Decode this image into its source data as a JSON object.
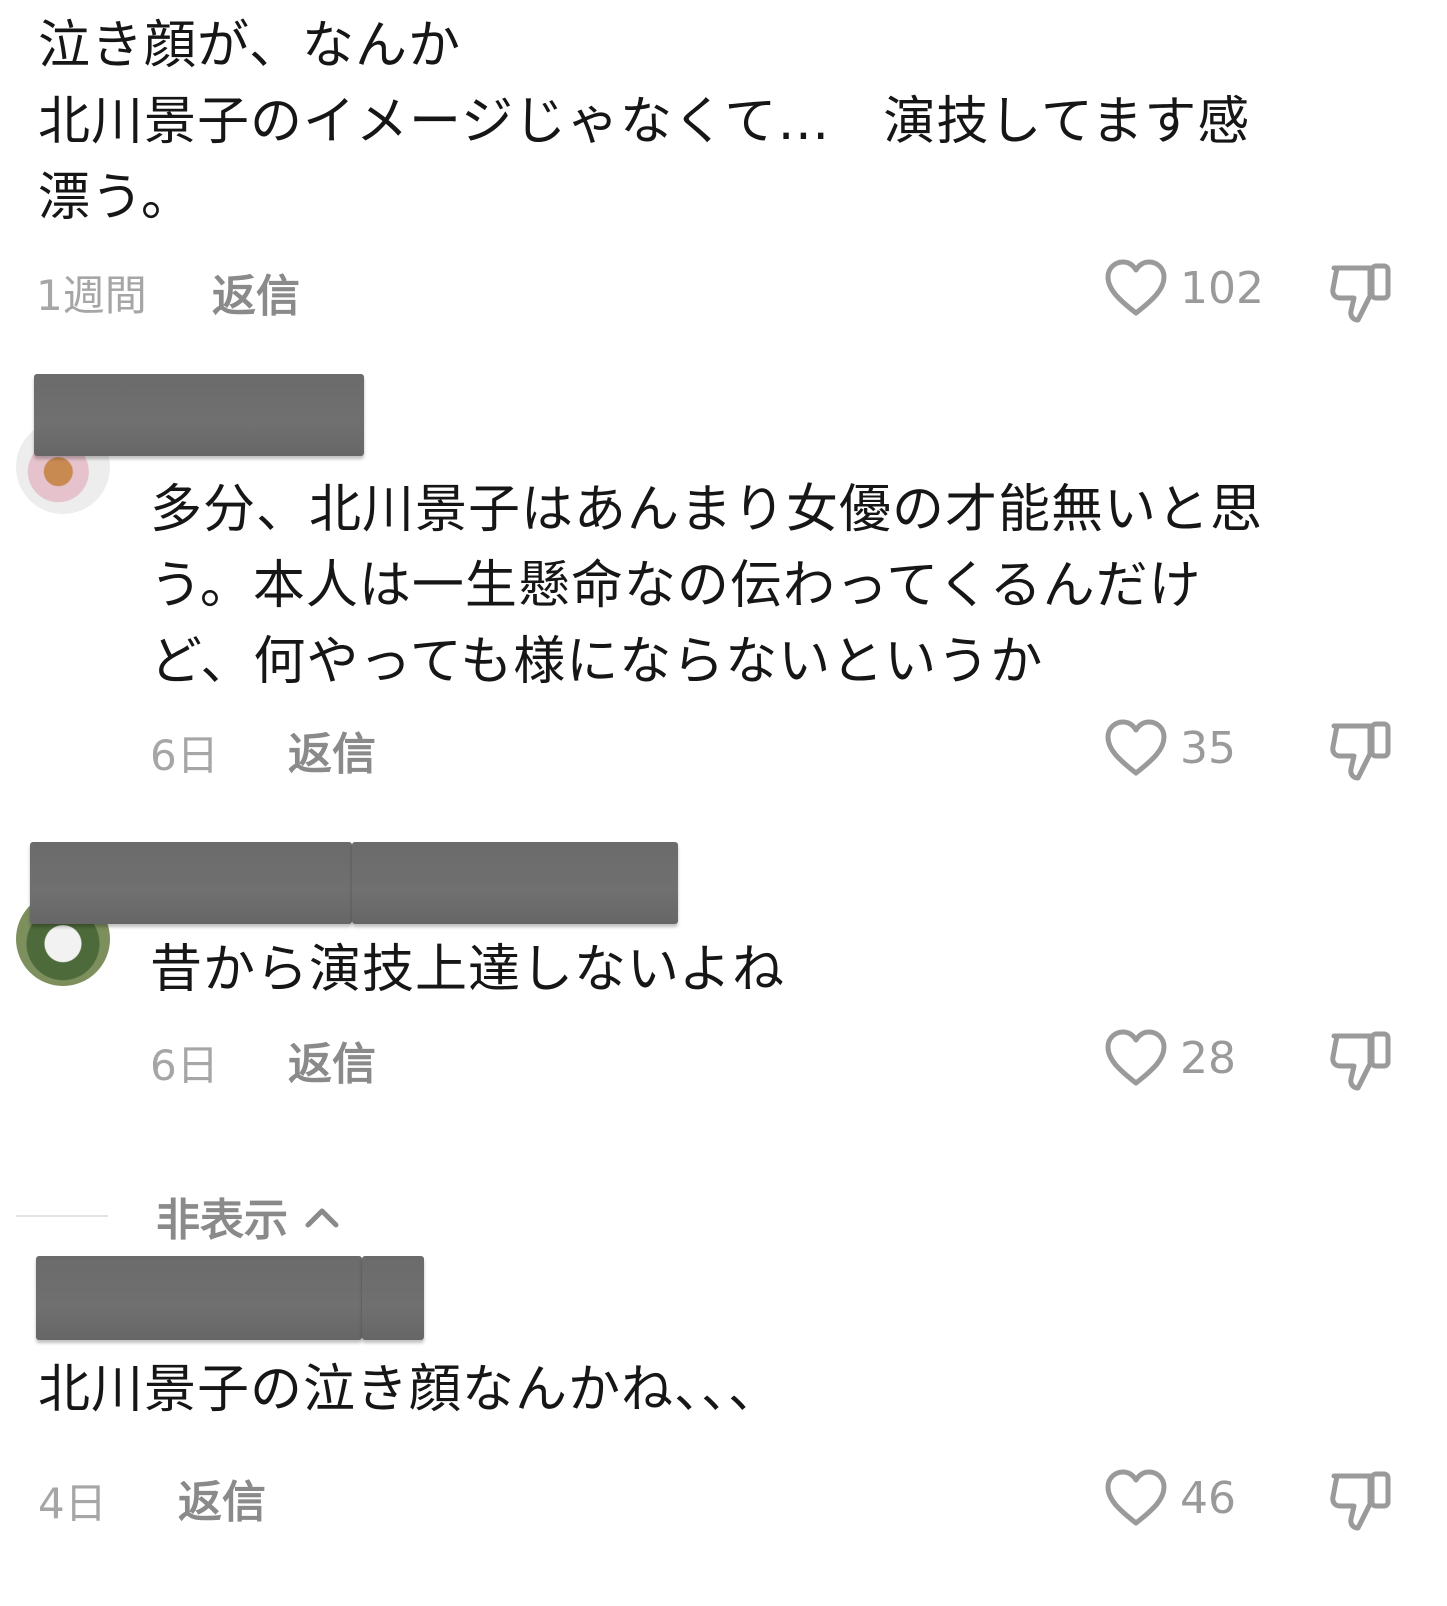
{
  "comments": [
    {
      "text": "泣き顔が、なんか\n北川景子のイメージじゃなくて…　演技してます感\n漂う。",
      "time": "1週間",
      "reply_label": "返信",
      "likes": "102"
    },
    {
      "text": "多分、北川景子はあんまり女優の才能無いと思\nう。本人は一生懸命なの伝わってくるんだけ\nど、何やっても様にならないというか",
      "time": "6日",
      "reply_label": "返信",
      "likes": "35"
    },
    {
      "text": "昔から演技上達しないよね",
      "time": "6日",
      "reply_label": "返信",
      "likes": "28"
    },
    {
      "text": "北川景子の泣き顔なんかね、、、",
      "time": "4日",
      "reply_label": "返信",
      "likes": "46"
    }
  ],
  "hide_replies": {
    "label": "非表示",
    "icon": "chevron-up-icon"
  },
  "icons": {
    "like": "heart-outline-icon",
    "dislike": "thumbs-down-icon"
  },
  "colors": {
    "text": "#161616",
    "muted": "#a6a6a6",
    "redaction": "#6e6e6e"
  }
}
